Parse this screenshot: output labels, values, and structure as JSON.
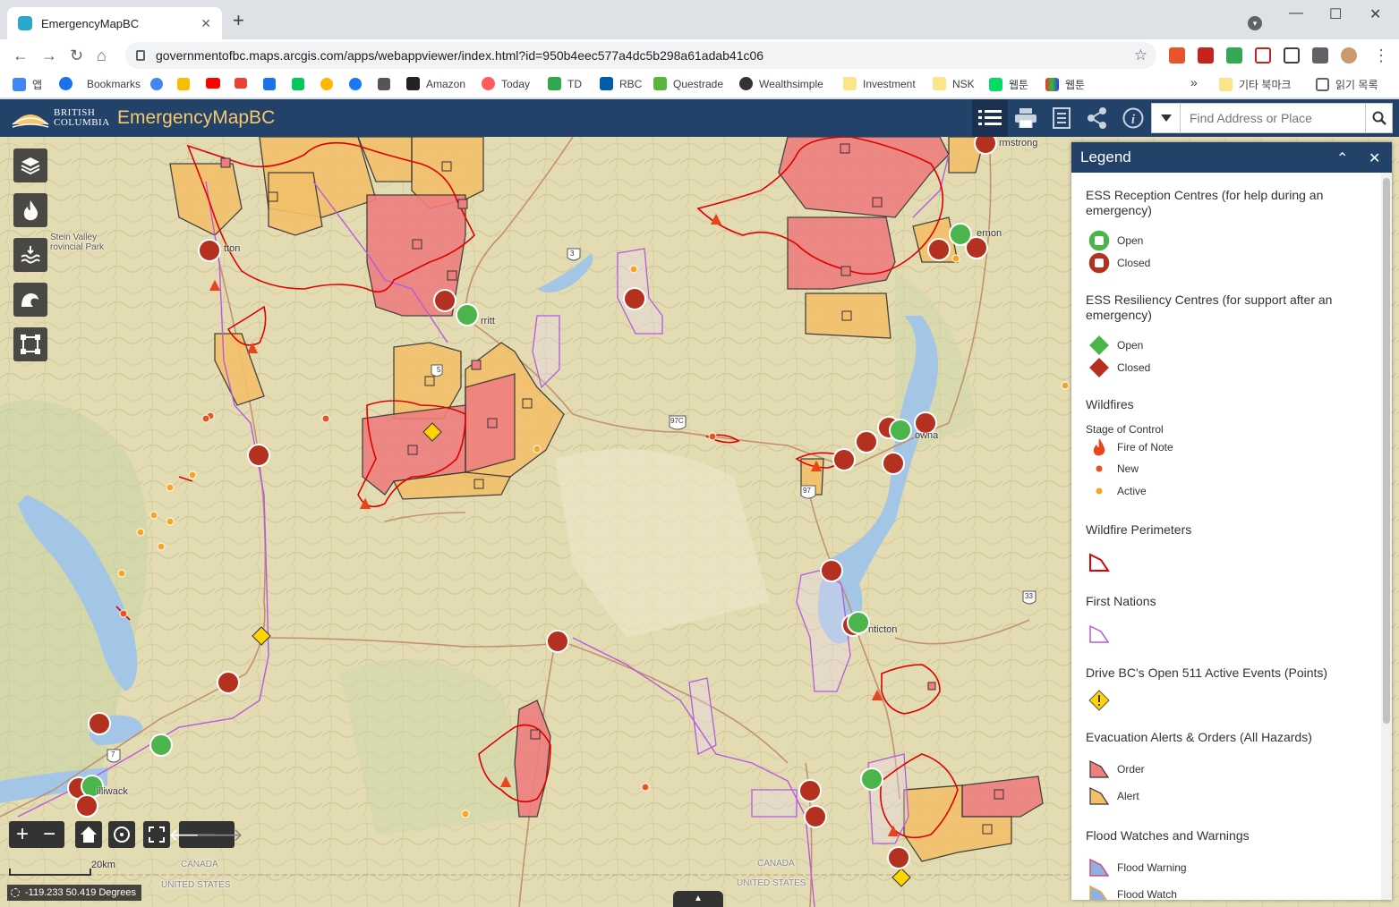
{
  "browser": {
    "tab_title": "EmergencyMapBC",
    "url": "governmentofbc.maps.arcgis.com/apps/webappviewer/index.html?id=950b4eec577a4dc5b298a61adab41c06"
  },
  "bookmarks": {
    "apps": "앱",
    "bookmarks": "Bookmarks",
    "amazon": "Amazon",
    "today": "Today",
    "td": "TD",
    "rbc": "RBC",
    "questrade": "Questrade",
    "wealthsimple": "Wealthsimple",
    "investment": "Investment",
    "nsk": "NSK",
    "webtoon1": "웹툰",
    "webtoon2": "웹툰",
    "more": "»",
    "other": "기타 북마크",
    "reading": "읽기 목록"
  },
  "app": {
    "org_line1": "BRITISH",
    "org_line2": "COLUMBIA",
    "title": "EmergencyMapBC",
    "search_placeholder": "Find Address or Place"
  },
  "map": {
    "labels": {
      "armstrong": "rmstrong",
      "vernon": "ernon",
      "lytton": "tton",
      "merritt": "rritt",
      "stein1": "Stein Valley",
      "stein2": "rovincial Park",
      "kelowna": "owna",
      "penticton": "nticton",
      "chilliwack": "illiwack",
      "canada1": "CANADA",
      "usa1": "UNITED STATES",
      "canada2": "CANADA",
      "usa2": "UNITED STATES",
      "hwy5": "5",
      "hwy97c": "97C",
      "hwy97": "97",
      "hwy33": "33",
      "hwy7": "7",
      "hwy3": "3"
    },
    "scale": "20km",
    "coords": "-119.233 50.419 Degrees",
    "pullup": "▲"
  },
  "legend": {
    "title": "Legend",
    "sections": {
      "reception": "ESS Reception Centres (for help during an emergency)",
      "resiliency": "ESS Resiliency Centres (for support after an emergency)",
      "wildfires": "Wildfires",
      "stage": "Stage of Control",
      "perimeters": "Wildfire Perimeters",
      "first_nations": "First Nations",
      "drivebc": "Drive BC's Open 511 Active Events (Points)",
      "evac": "Evacuation Alerts & Orders (All Hazards)",
      "flood": "Flood Watches and Warnings"
    },
    "items": {
      "open1": "Open",
      "closed1": "Closed",
      "open2": "Open",
      "closed2": "Closed",
      "fire_of_note": "Fire of Note",
      "new": "New",
      "active": "Active",
      "order": "Order",
      "alert": "Alert",
      "flood_warning": "Flood Warning",
      "flood_watch": "Flood Watch"
    }
  },
  "colors": {
    "header": "#23426a",
    "title_accent": "#f7c86a",
    "order_fill": "#ef7f7f",
    "alert_fill": "#f3c06a",
    "perimeter": "#e00000",
    "first_nations": "#b65ae0",
    "ess_open": "#4bb54b",
    "ess_closed": "#b5311f"
  }
}
